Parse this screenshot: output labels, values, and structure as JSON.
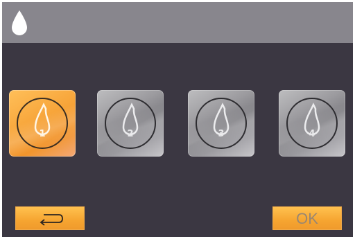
{
  "header": {
    "icon": "water-drop-icon"
  },
  "tiles": [
    {
      "label": "1",
      "icon": "water-drop-icon",
      "selected": true
    },
    {
      "label": "2",
      "icon": "water-drop-icon",
      "selected": false
    },
    {
      "label": "3",
      "icon": "water-drop-icon",
      "selected": false
    },
    {
      "label": "4",
      "icon": "water-drop-icon",
      "selected": false
    }
  ],
  "footer": {
    "back_icon": "return-arrow-icon",
    "ok_label": "OK"
  },
  "colors": {
    "background": "#3b3742",
    "titlebar": "#88868d",
    "accent": "#f6a531",
    "tile_inactive": "#9c9b9f"
  }
}
